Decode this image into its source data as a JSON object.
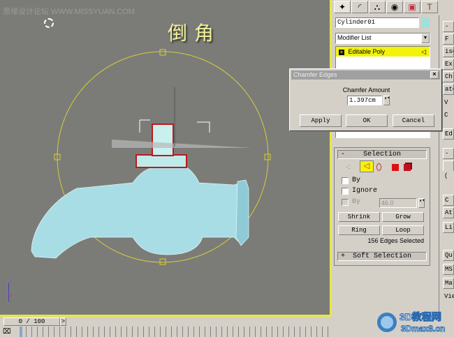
{
  "viewport": {
    "watermark": "思缘设计论坛 WWW.MISSYUAN.COM",
    "title_overlay": "倒角",
    "axis_labels": {
      "z": "z",
      "x": "x",
      "y": "y"
    }
  },
  "command_panel": {
    "tabs": [
      {
        "name": "create",
        "glyph": "✦"
      },
      {
        "name": "modify",
        "glyph": "◜"
      },
      {
        "name": "hierarchy",
        "glyph": "⛬"
      },
      {
        "name": "motion",
        "glyph": "◉"
      },
      {
        "name": "display",
        "glyph": "▣"
      },
      {
        "name": "utilities",
        "glyph": "T"
      }
    ],
    "object_name": "Cylinder01",
    "object_color": "#9fe0dc",
    "modifier_list": "Modifier List",
    "stack": [
      {
        "label": "Editable Poly",
        "expand": "+"
      }
    ],
    "selection_rollout": {
      "toggle": "-",
      "title": "Selection",
      "by_vertex": "By",
      "ignore": "Ignore",
      "by_angle": "By",
      "angle_value": "46.0",
      "shrink": "Shrink",
      "grow": "Grow",
      "ring": "Ring",
      "loop": "Loop",
      "status": "156 Edges Selected"
    },
    "soft_selection": {
      "toggle": "+",
      "title": "Soft Selection"
    }
  },
  "right_panel_truncated": [
    "-",
    "F",
    "ise",
    "Ex",
    "Ch",
    "atc",
    "V",
    "C",
    "Ed",
    "-",
    "(",
    "C",
    "At",
    "Li",
    "Qu",
    "MS",
    "Ma",
    "Vie"
  ],
  "dialog": {
    "title": "Chamfer Edges",
    "close": "×",
    "label": "Chamfer Amount",
    "value": "1.397cm",
    "apply": "Apply",
    "ok": "OK",
    "cancel": "Cancel"
  },
  "timeline": {
    "frame": "0 / 100",
    "next": ">"
  },
  "logo": {
    "line1": "3D教程网",
    "line2": "3Dmax8.cn"
  }
}
